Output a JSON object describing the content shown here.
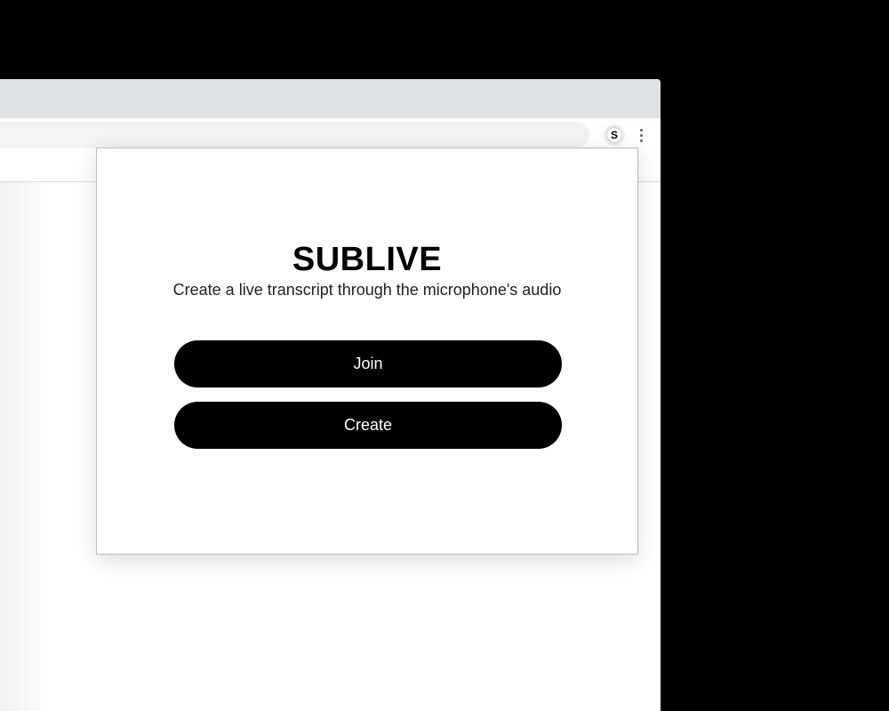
{
  "browser": {
    "extension": {
      "icon": "sublive-extension-icon",
      "letter": "S"
    },
    "menu_icon": "more-vert-icon"
  },
  "popup": {
    "title": "SUBLIVE",
    "subtitle": "Create a live transcript through the microphone's audio",
    "join_label": "Join",
    "create_label": "Create"
  },
  "colors": {
    "background": "#000000",
    "button": "#000000",
    "button_text": "#ffffff",
    "tabstrip": "#dee1e6",
    "omnibox": "#f1f3f4"
  }
}
